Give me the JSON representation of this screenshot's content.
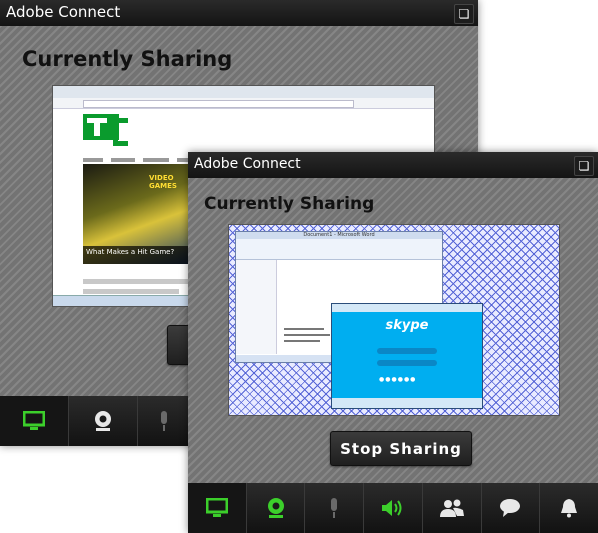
{
  "back_window": {
    "title": "Adobe Connect",
    "heading": "Currently Sharing",
    "shared_screen": {
      "hero_text": "VIDEO GAMES",
      "hero_caption": "What Makes a Hit Game?"
    },
    "toolbar": {
      "items": [
        {
          "name": "share",
          "icon": "screen-icon",
          "active": true
        },
        {
          "name": "camera",
          "icon": "webcam-icon",
          "active": false
        },
        {
          "name": "microphone",
          "icon": "microphone-icon",
          "active": false
        }
      ]
    }
  },
  "front_window": {
    "title": "Adobe Connect",
    "heading": "Currently Sharing",
    "stop_button_label": "Stop Sharing",
    "shared_screen": {
      "word_title": "Document1 - Microsoft Word",
      "skype_logo": "skype"
    },
    "toolbar": {
      "items": [
        {
          "name": "share",
          "icon": "screen-icon",
          "active": true
        },
        {
          "name": "camera",
          "icon": "webcam-icon",
          "active": false
        },
        {
          "name": "microphone",
          "icon": "microphone-icon",
          "active": false
        },
        {
          "name": "speaker",
          "icon": "speaker-icon",
          "active": false
        },
        {
          "name": "attendees",
          "icon": "people-icon",
          "active": false
        },
        {
          "name": "chat",
          "icon": "chat-bubble-icon",
          "active": false
        },
        {
          "name": "notifications",
          "icon": "bell-icon",
          "active": false
        }
      ]
    }
  },
  "colors": {
    "active_green": "#3ccf2b",
    "titlebar": "#1a1a1a",
    "panel_grey": "#7b7b7b"
  }
}
